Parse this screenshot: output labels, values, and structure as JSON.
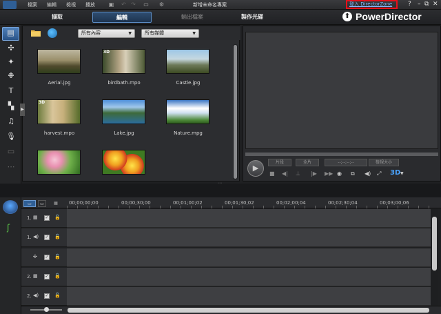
{
  "titlebar": {
    "menus": [
      "檔案",
      "編輯",
      "檢視",
      "播放"
    ],
    "window_title": "新增未命名專案",
    "login_link": "登入 DirectorZone",
    "help": "?"
  },
  "modes": {
    "capture": "擷取",
    "edit": "編輯",
    "produce": "輸出檔案",
    "disc": "製作光碟"
  },
  "brand": "PowerDirector",
  "library": {
    "filter_content": "所有內容",
    "filter_media": "所有媒體",
    "items": [
      {
        "label": "Aerial.jpg",
        "badge": ""
      },
      {
        "label": "birdbath.mpo",
        "badge": "3D"
      },
      {
        "label": "Castle.jpg",
        "badge": ""
      },
      {
        "label": "harvest.mpo",
        "badge": "3D"
      },
      {
        "label": "Lake.jpg",
        "badge": ""
      },
      {
        "label": "Nature.mpg",
        "badge": ""
      },
      {
        "label": "",
        "badge": ""
      },
      {
        "label": "",
        "badge": ""
      }
    ]
  },
  "preview": {
    "clip_btn": "片段",
    "movie_btn": "全片",
    "timecode": "--;--;--;--",
    "size": "檢視大小",
    "d3": "3D"
  },
  "timeline": {
    "ruler": [
      "00;00;00;00",
      "00;00;30;00",
      "00;01;00;02",
      "00;01;30;02",
      "00;02;00;04",
      "00;02;30;04",
      "00;03;00;06"
    ],
    "tracks": [
      {
        "num": "1.",
        "type": "video"
      },
      {
        "num": "1.",
        "type": "audio"
      },
      {
        "num": "",
        "type": "fx"
      },
      {
        "num": "2.",
        "type": "video"
      },
      {
        "num": "2.",
        "type": "audio"
      }
    ]
  }
}
